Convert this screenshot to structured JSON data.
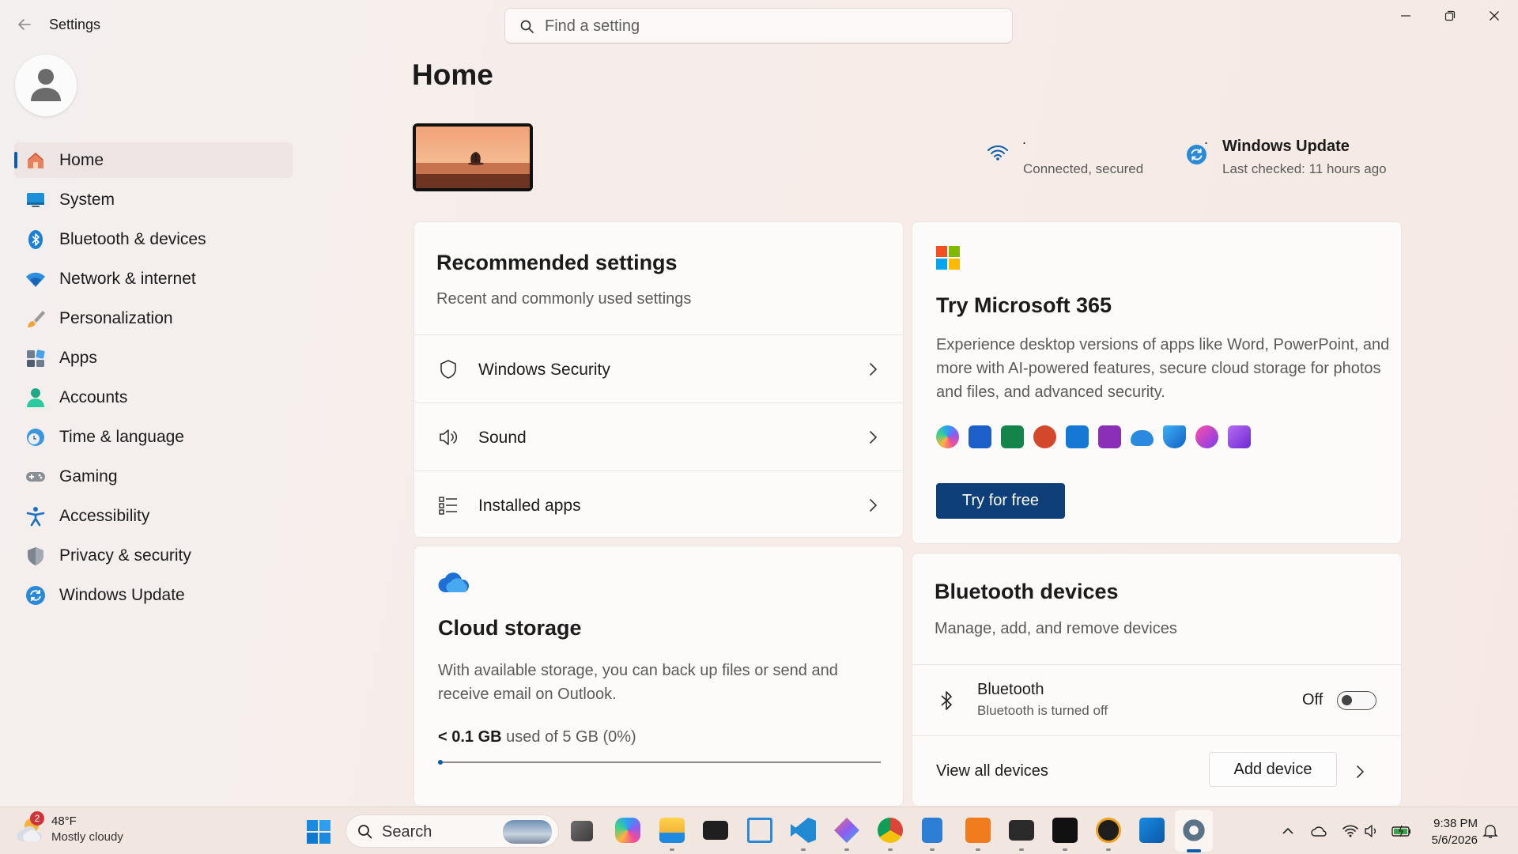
{
  "window": {
    "title": "Settings"
  },
  "search": {
    "placeholder": "Find a setting"
  },
  "sidebar": {
    "items": [
      {
        "label": "Home",
        "icon": "home-icon",
        "active": true
      },
      {
        "label": "System",
        "icon": "system-icon"
      },
      {
        "label": "Bluetooth & devices",
        "icon": "bluetooth-icon"
      },
      {
        "label": "Network & internet",
        "icon": "wifi-icon"
      },
      {
        "label": "Personalization",
        "icon": "brush-icon"
      },
      {
        "label": "Apps",
        "icon": "apps-icon"
      },
      {
        "label": "Accounts",
        "icon": "person-icon"
      },
      {
        "label": "Time & language",
        "icon": "clock-globe-icon"
      },
      {
        "label": "Gaming",
        "icon": "gamepad-icon"
      },
      {
        "label": "Accessibility",
        "icon": "accessibility-icon"
      },
      {
        "label": "Privacy & security",
        "icon": "shield-icon"
      },
      {
        "label": "Windows Update",
        "icon": "update-icon"
      }
    ]
  },
  "main": {
    "title": "Home",
    "network": {
      "name": ". .",
      "status": "Connected, secured"
    },
    "update": {
      "title": "Windows Update",
      "status": "Last checked: 11 hours ago"
    },
    "recommended": {
      "title": "Recommended settings",
      "subtitle": "Recent and commonly used settings",
      "rows": [
        {
          "label": "Windows Security",
          "icon": "shield-outline-icon"
        },
        {
          "label": "Sound",
          "icon": "speaker-icon"
        },
        {
          "label": "Installed apps",
          "icon": "list-icon"
        }
      ]
    },
    "m365": {
      "title": "Try Microsoft 365",
      "description": "Experience desktop versions of apps like Word, PowerPoint, and more with AI-powered features, secure cloud storage for photos and files, and advanced security.",
      "button": "Try for free",
      "apps": [
        "copilot",
        "word",
        "excel",
        "powerpoint",
        "outlook",
        "onenote",
        "onedrive",
        "defender",
        "designer",
        "clipchamp"
      ]
    },
    "cloud": {
      "title": "Cloud storage",
      "description": "With available storage, you can back up files or send and receive email on Outlook.",
      "used": "< 0.1 GB",
      "total_text": "used of 5 GB (0%)",
      "used_fraction": 0.0
    },
    "bluetooth": {
      "title": "Bluetooth devices",
      "subtitle": "Manage, add, and remove devices",
      "row_title": "Bluetooth",
      "row_status": "Bluetooth is turned off",
      "toggle_label": "Off",
      "toggle_on": false,
      "view_all": "View all devices",
      "add_device": "Add device"
    }
  },
  "taskbar": {
    "weather": {
      "temp": "48°F",
      "condition": "Mostly cloudy",
      "badge": "2"
    },
    "search_label": "Search",
    "apps": [
      "file-explorer-grey",
      "copilot",
      "file-explorer",
      "terminal",
      "snipping-tool",
      "vscode",
      "app-bolt",
      "chrome",
      "notepad",
      "xampp",
      "cmd",
      "app-z",
      "media-player",
      "app-store",
      "settings"
    ],
    "clock": {
      "time": "9:38 PM",
      "date": "5/6/2026"
    }
  },
  "colors": {
    "accent": "#0b5cad",
    "button_primary": "#0f3f78",
    "background": "#f5ede9"
  }
}
